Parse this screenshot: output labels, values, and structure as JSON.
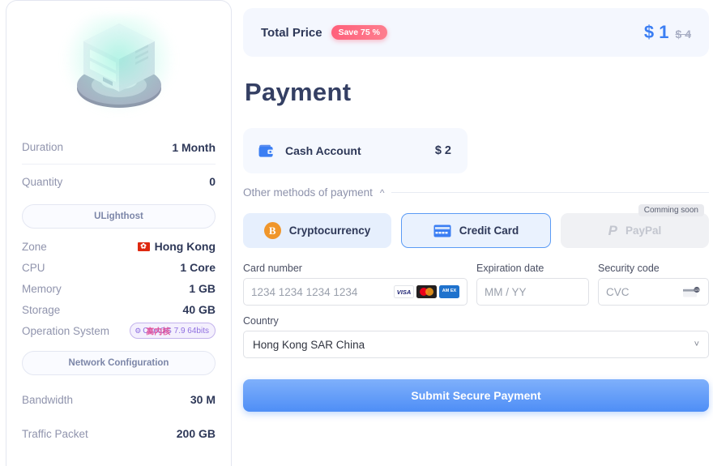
{
  "sidebar": {
    "illustration_name": "server-illustration",
    "specs": [
      {
        "label": "Duration",
        "value": "1 Month"
      },
      {
        "label": "Quantity",
        "value": "0"
      }
    ],
    "provider_button": "ULighthost",
    "zone": {
      "label": "Zone",
      "value": "Hong Kong",
      "flag": "hong-kong-flag"
    },
    "cpu": {
      "label": "CPU",
      "value": "1 Core"
    },
    "memory": {
      "label": "Memory",
      "value": "1 GB"
    },
    "storage": {
      "label": "Storage",
      "value": "40 GB"
    },
    "os": {
      "label": "Operation System",
      "badge": "CentOS 7.9 64bits",
      "badge_overlay": "高内核"
    },
    "network_button": "Network Configuration",
    "bandwidth": {
      "label": "Bandwidth",
      "value": "30 M"
    },
    "traffic": {
      "label": "Traffic Packet",
      "value": "200 GB"
    }
  },
  "total": {
    "label": "Total Price",
    "save_badge": "Save 75 %",
    "price_symbol": "$",
    "price": "1",
    "price_original": "$ 4"
  },
  "page_title": "Payment",
  "cash_account": {
    "name": "Cash Account",
    "amount": "$ 2"
  },
  "other_methods": {
    "label": "Other methods of payment"
  },
  "methods": {
    "crypto": "Cryptocurrency",
    "credit": "Credit Card",
    "paypal": "PayPal",
    "paypal_tooltip": "Comming soon"
  },
  "form": {
    "card_number_label": "Card number",
    "card_number_placeholder": "1234 1234 1234 1234",
    "expiration_label": "Expiration date",
    "expiration_placeholder": "MM / YY",
    "security_label": "Security code",
    "security_placeholder": "CVC",
    "country_label": "Country",
    "country_value": "Hong Kong SAR China",
    "brands": {
      "visa": "VISA",
      "amex": "AM EX"
    }
  },
  "submit_button": "Submit Secure Payment",
  "colors": {
    "accent": "#3b7ef3",
    "save": "#ff5f7a",
    "navy": "#2e3858",
    "bitcoin": "#f0962b"
  }
}
